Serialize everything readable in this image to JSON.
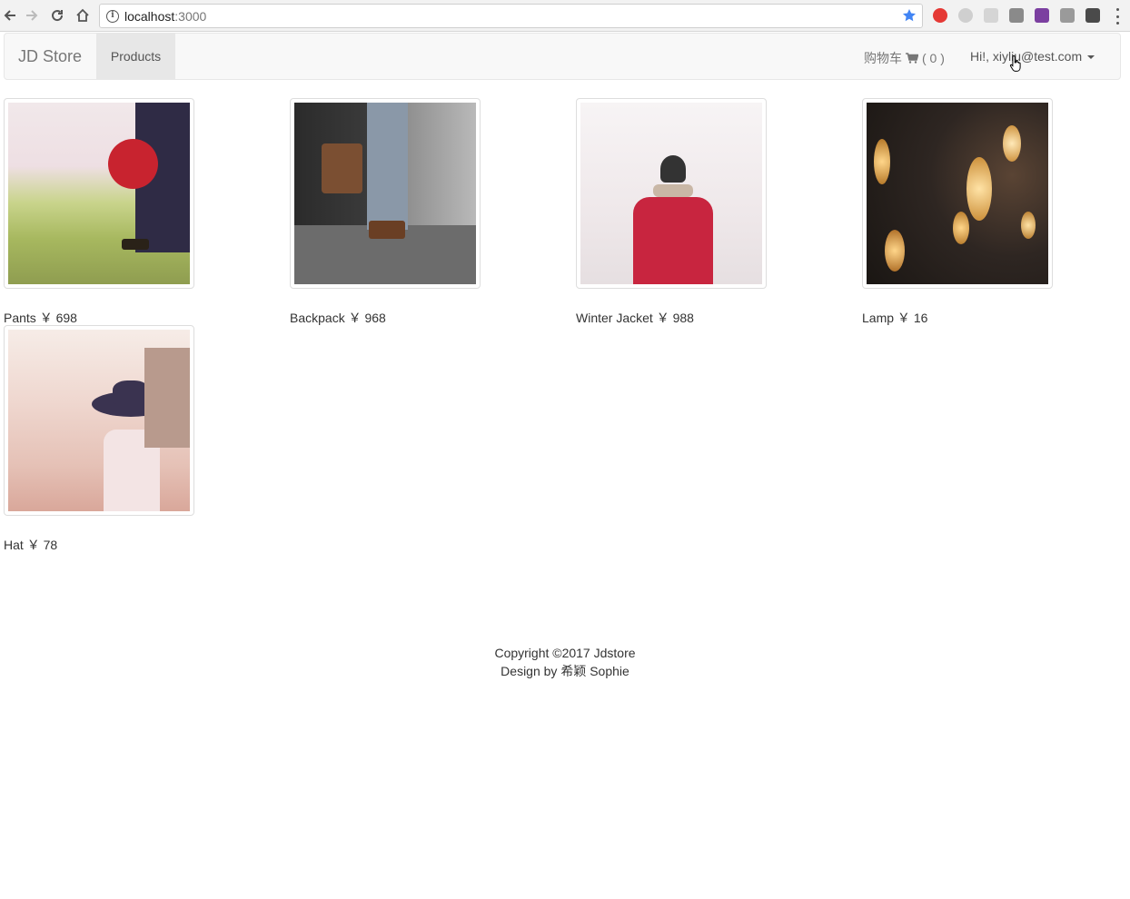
{
  "browser": {
    "url_host": "localhost",
    "url_port": ":3000"
  },
  "navbar": {
    "brand": "JD Store",
    "products_label": "Products",
    "cart_label": "购物车",
    "cart_count": "( 0 )",
    "user_greeting": "Hi!, xiyliu@test.com"
  },
  "products": [
    {
      "name": "Pants",
      "currency": "￥",
      "price": "698"
    },
    {
      "name": "Backpack",
      "currency": "￥",
      "price": "968"
    },
    {
      "name": "Winter Jacket",
      "currency": "￥",
      "price": "988"
    },
    {
      "name": "Lamp",
      "currency": "￥",
      "price": "16"
    },
    {
      "name": "Hat",
      "currency": "￥",
      "price": "78"
    }
  ],
  "footer": {
    "copyright": "Copyright ©2017 Jdstore",
    "design": "Design by 希颖 Sophie"
  },
  "colors": {
    "navbar_bg": "#f8f8f8",
    "active_tab_bg": "#e7e7e7",
    "link_muted": "#777777",
    "bookmark_star": "#4285f4"
  }
}
